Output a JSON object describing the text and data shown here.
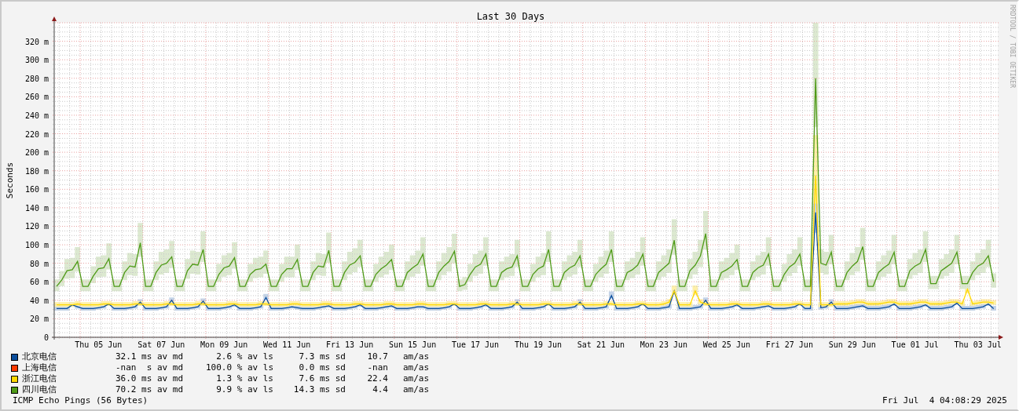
{
  "watermark_credit": "RRDTOOL / TOBI OETIKER",
  "chart": {
    "chart_data": {
      "type": "line",
      "title": "Last 30 Days",
      "ylabel": "Seconds",
      "categories": [
        null,
        null,
        null,
        null,
        null,
        null,
        null,
        null,
        "Thu 05 Jun",
        null,
        null,
        null,
        null,
        null,
        null,
        null,
        null,
        null,
        null,
        null,
        "Sat 07 Jun",
        null,
        null,
        null,
        null,
        null,
        null,
        null,
        null,
        null,
        null,
        null,
        "Mon 09 Jun",
        null,
        null,
        null,
        null,
        null,
        null,
        null,
        null,
        null,
        null,
        null,
        "Wed 11 Jun",
        null,
        null,
        null,
        null,
        null,
        null,
        null,
        null,
        null,
        null,
        null,
        "Fri 13 Jun",
        null,
        null,
        null,
        null,
        null,
        null,
        null,
        null,
        null,
        null,
        null,
        "Sun 15 Jun",
        null,
        null,
        null,
        null,
        null,
        null,
        null,
        null,
        null,
        null,
        null,
        "Tue 17 Jun",
        null,
        null,
        null,
        null,
        null,
        null,
        null,
        null,
        null,
        null,
        null,
        "Thu 19 Jun",
        null,
        null,
        null,
        null,
        null,
        null,
        null,
        null,
        null,
        null,
        null,
        "Sat 21 Jun",
        null,
        null,
        null,
        null,
        null,
        null,
        null,
        null,
        null,
        null,
        null,
        "Mon 23 Jun",
        null,
        null,
        null,
        null,
        null,
        null,
        null,
        null,
        null,
        null,
        null,
        "Wed 25 Jun",
        null,
        null,
        null,
        null,
        null,
        null,
        null,
        null,
        null,
        null,
        null,
        "Fri 27 Jun",
        null,
        null,
        null,
        null,
        null,
        null,
        null,
        null,
        null,
        null,
        null,
        "Sun 29 Jun",
        null,
        null,
        null,
        null,
        null,
        null,
        null,
        null,
        null,
        null,
        null,
        "Tue 01 Jul",
        null,
        null,
        null,
        null,
        null,
        null,
        null,
        null,
        null,
        null,
        null,
        "Thu 03 Jul",
        null,
        null,
        null
      ],
      "series": [
        {
          "color": "#0b4e9c",
          "values": [
            31,
            31,
            31,
            35,
            33,
            31,
            31,
            31,
            32,
            33,
            36,
            31,
            31,
            31,
            32,
            33,
            38,
            31,
            31,
            31,
            32,
            33,
            40,
            31,
            31,
            31,
            32,
            33,
            39,
            31,
            31,
            31,
            32,
            33,
            35,
            31,
            31,
            31,
            32,
            33,
            43,
            31,
            31,
            31,
            32,
            33,
            32,
            31,
            31,
            31,
            32,
            33,
            34,
            31,
            31,
            31,
            32,
            33,
            35,
            31,
            31,
            31,
            32,
            33,
            34,
            31,
            31,
            31,
            32,
            33,
            33,
            31,
            31,
            31,
            32,
            33,
            36,
            31,
            31,
            31,
            32,
            33,
            35,
            31,
            31,
            31,
            32,
            33,
            38,
            31,
            31,
            31,
            32,
            33,
            36,
            31,
            31,
            31,
            32,
            33,
            38,
            31,
            31,
            31,
            32,
            33,
            45,
            31,
            31,
            31,
            32,
            33,
            36,
            31,
            31,
            31,
            32,
            33,
            50,
            31,
            31,
            31,
            32,
            33,
            40,
            31,
            31,
            31,
            32,
            33,
            35,
            31,
            31,
            31,
            32,
            33,
            34,
            31,
            31,
            31,
            32,
            33,
            36,
            31,
            31,
            135,
            32,
            33,
            38,
            31,
            31,
            31,
            32,
            33,
            34,
            31,
            31,
            31,
            32,
            33,
            36,
            31,
            31,
            31,
            32,
            33,
            35,
            31,
            31,
            31,
            32,
            33,
            37,
            31,
            31,
            31,
            32,
            33,
            36,
            31
          ]
        },
        {
          "color": "#ffd800",
          "values": [
            35,
            35,
            35,
            35,
            36,
            35,
            35,
            35,
            35,
            36,
            36,
            35,
            35,
            35,
            35,
            36,
            36,
            35,
            35,
            35,
            35,
            36,
            36,
            35,
            35,
            35,
            35,
            36,
            36,
            35,
            35,
            35,
            35,
            36,
            36,
            35,
            35,
            35,
            35,
            36,
            36,
            35,
            35,
            35,
            35,
            36,
            36,
            35,
            35,
            35,
            35,
            36,
            36,
            35,
            35,
            35,
            35,
            36,
            36,
            35,
            35,
            35,
            35,
            36,
            36,
            35,
            35,
            35,
            35,
            36,
            36,
            35,
            35,
            35,
            35,
            36,
            36,
            35,
            35,
            35,
            35,
            36,
            36,
            35,
            35,
            35,
            35,
            36,
            36,
            35,
            35,
            35,
            35,
            36,
            36,
            35,
            35,
            35,
            35,
            36,
            36,
            35,
            35,
            35,
            35,
            36,
            36,
            35,
            35,
            35,
            35,
            36,
            36,
            35,
            35,
            35,
            36,
            38,
            50,
            35,
            35,
            35,
            50,
            38,
            36,
            35,
            35,
            35,
            35,
            36,
            36,
            35,
            35,
            35,
            35,
            36,
            36,
            35,
            35,
            35,
            35,
            36,
            36,
            35,
            35,
            175,
            35,
            35,
            35,
            36,
            36,
            36,
            37,
            38,
            38,
            36,
            36,
            36,
            37,
            38,
            38,
            36,
            36,
            36,
            37,
            38,
            38,
            36,
            36,
            36,
            37,
            38,
            38,
            36,
            52,
            36,
            37,
            38,
            38,
            37
          ]
        },
        {
          "color": "#4e9a17",
          "values": [
            55,
            62,
            72,
            73,
            82,
            55,
            55,
            66,
            74,
            75,
            85,
            55,
            55,
            70,
            77,
            76,
            102,
            55,
            55,
            70,
            78,
            80,
            87,
            55,
            55,
            72,
            79,
            78,
            95,
            55,
            55,
            68,
            75,
            77,
            86,
            55,
            55,
            68,
            73,
            74,
            79,
            55,
            55,
            68,
            74,
            74,
            84,
            55,
            55,
            70,
            77,
            76,
            94,
            55,
            55,
            70,
            78,
            81,
            88,
            55,
            55,
            68,
            74,
            78,
            84,
            55,
            55,
            70,
            75,
            79,
            90,
            55,
            55,
            70,
            77,
            82,
            93,
            55,
            57,
            68,
            76,
            79,
            90,
            55,
            55,
            70,
            74,
            76,
            88,
            55,
            55,
            68,
            74,
            77,
            95,
            55,
            55,
            70,
            75,
            78,
            88,
            55,
            55,
            68,
            74,
            79,
            95,
            55,
            55,
            70,
            73,
            78,
            90,
            55,
            55,
            70,
            75,
            80,
            105,
            55,
            55,
            72,
            78,
            88,
            112,
            55,
            55,
            70,
            73,
            77,
            84,
            55,
            55,
            70,
            75,
            78,
            90,
            55,
            55,
            68,
            76,
            80,
            90,
            55,
            55,
            280,
            80,
            78,
            92,
            55,
            55,
            70,
            77,
            82,
            98,
            55,
            55,
            70,
            75,
            79,
            92,
            55,
            55,
            72,
            77,
            80,
            95,
            58,
            58,
            72,
            76,
            80,
            92,
            58,
            58,
            70,
            77,
            80,
            88,
            60
          ]
        }
      ],
      "grid": true,
      "ylim": [
        0,
        340
      ],
      "yticks": [
        {
          "value": 0,
          "label": "0"
        },
        {
          "value": 20,
          "label": "20 m"
        },
        {
          "value": 40,
          "label": "40 m"
        },
        {
          "value": 60,
          "label": "60 m"
        },
        {
          "value": 80,
          "label": "80 m"
        },
        {
          "value": 100,
          "label": "100 m"
        },
        {
          "value": 120,
          "label": "120 m"
        },
        {
          "value": 140,
          "label": "140 m"
        },
        {
          "value": 160,
          "label": "160 m"
        },
        {
          "value": 180,
          "label": "180 m"
        },
        {
          "value": 200,
          "label": "200 m"
        },
        {
          "value": 220,
          "label": "220 m"
        },
        {
          "value": 240,
          "label": "240 m"
        },
        {
          "value": 260,
          "label": "260 m"
        },
        {
          "value": 280,
          "label": "280 m"
        },
        {
          "value": 300,
          "label": "300 m"
        },
        {
          "value": 320,
          "label": "320 m"
        }
      ]
    }
  },
  "legend": [
    {
      "name": "北京电信",
      "color": "#0b4e9c",
      "stats": [
        "32.1 ms av md",
        "2.6 % av ls",
        "7.3 ms sd",
        "10.7",
        "am/as"
      ]
    },
    {
      "name": "上海电信",
      "color": "#ff3a00",
      "stats": [
        "-nan  s av md",
        "100.0 % av ls",
        "0.0 ms sd",
        "-nan",
        "am/as"
      ]
    },
    {
      "name": "浙江电信",
      "color": "#ffd800",
      "stats": [
        "36.0 ms av md",
        "1.3 % av ls",
        "7.6 ms sd",
        "22.4",
        "am/as"
      ]
    },
    {
      "name": "四川电信",
      "color": "#4e9a17",
      "stats": [
        "70.2 ms av md",
        "9.9 % av ls",
        "14.3 ms sd",
        "4.4",
        "am/as"
      ]
    }
  ],
  "footer": {
    "probe": "ICMP Echo Pings (56 Bytes)",
    "timestamp": "Fri Jul  4 04:08:29 2025"
  }
}
